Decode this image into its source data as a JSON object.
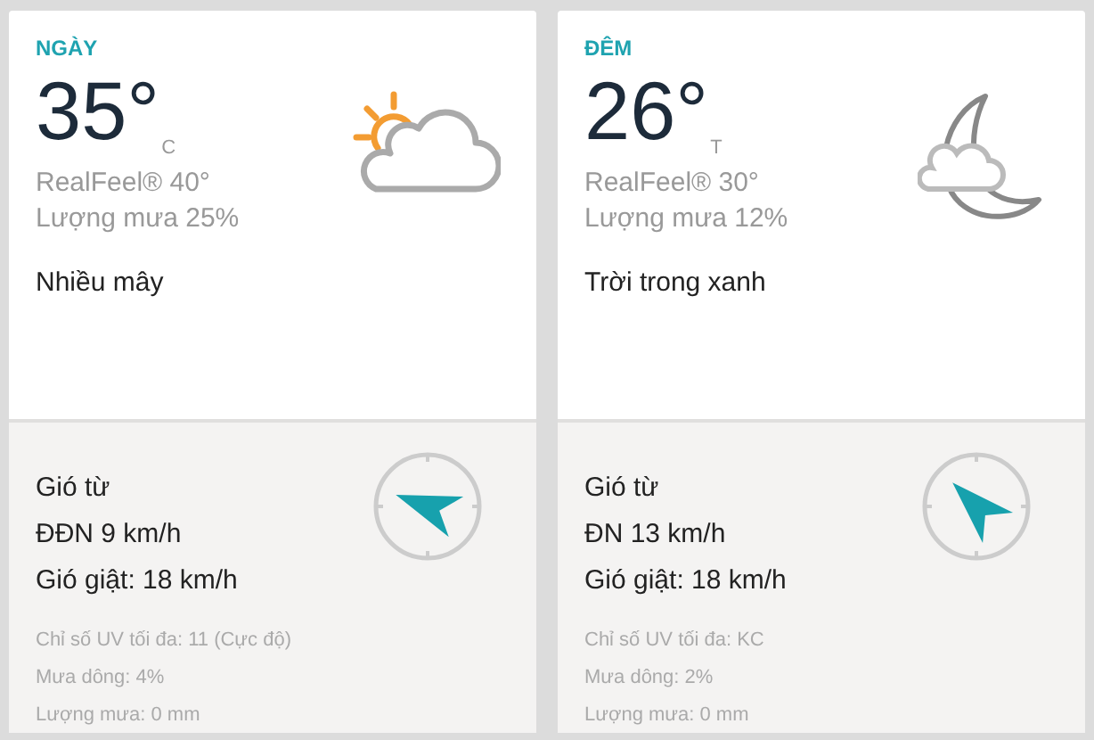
{
  "panels": [
    {
      "heading": "NGÀY",
      "temperature": "35°",
      "unit": "C",
      "weather_icon": {
        "kind": "sun-cloud"
      },
      "realfeel": "RealFeel® 40°",
      "precipitation": "Lượng mưa 25%",
      "condition": "Nhiều mây",
      "wind_label": "Gió từ",
      "wind": "ĐĐN 9 km/h",
      "wind_icon": {
        "kind": "ese"
      },
      "gusts": "Gió giật: 18 km/h",
      "details": [
        "Chỉ số UV tối đa: 11 (Cực độ)",
        "Mưa dông: 4%",
        "Lượng mưa: 0 mm"
      ]
    },
    {
      "heading": "ĐÊM",
      "temperature": "26°",
      "unit": "T",
      "weather_icon": {
        "kind": "moon-cloud"
      },
      "realfeel": "RealFeel® 30°",
      "precipitation": "Lượng mưa 12%",
      "condition": "Trời trong xanh",
      "wind_label": "Gió từ",
      "wind": "ĐN 13 km/h",
      "wind_icon": {
        "kind": "se"
      },
      "gusts": "Gió giật: 18 km/h",
      "details": [
        "Chỉ số UV tối đa: KC",
        "Mưa dông: 2%",
        "Lượng mưa: 0 mm"
      ]
    }
  ]
}
